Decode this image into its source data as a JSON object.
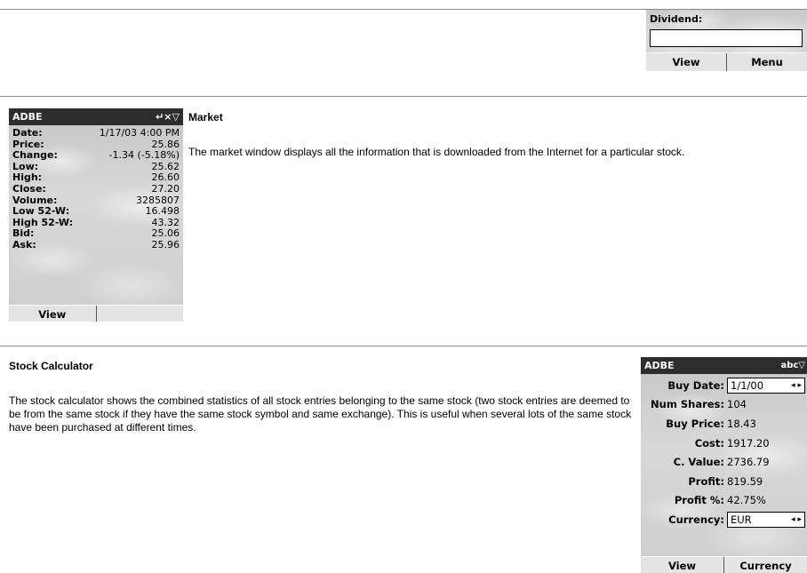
{
  "dividend_panel": {
    "label": "Dividend:",
    "value": "",
    "softkeys": [
      "View",
      "Menu"
    ]
  },
  "market_window": {
    "title": "ADBE",
    "title_icons": "↵×▽",
    "rows": [
      {
        "label": "Date:",
        "value": "1/17/03 4:00 PM"
      },
      {
        "label": "Price:",
        "value": "25.86"
      },
      {
        "label": "Change:",
        "value": "-1.34 (-5.18%)"
      },
      {
        "label": "Low:",
        "value": "25.62"
      },
      {
        "label": "High:",
        "value": "26.60"
      },
      {
        "label": "Close:",
        "value": "27.20"
      },
      {
        "label": "Volume:",
        "value": "3285807"
      },
      {
        "label": "Low 52-W:",
        "value": "16.498"
      },
      {
        "label": "High 52-W:",
        "value": "43.32"
      },
      {
        "label": "Bid:",
        "value": "25.06"
      },
      {
        "label": "Ask:",
        "value": "25.96"
      }
    ],
    "softkeys": [
      "View",
      ""
    ]
  },
  "market_section": {
    "heading": "Market",
    "text": "The market window displays all the information that is downloaded from the Internet for a particular stock."
  },
  "calculator_section": {
    "heading": "Stock Calculator",
    "text": "The stock calculator shows the combined statistics of all stock entries belonging to the same stock (two stock entries are deemed to be from the same stock if they have the same stock symbol and same exchange). This is useful when several lots of the same stock have been purchased at different times."
  },
  "calculator_window": {
    "title": "ADBE",
    "title_icons": "abc▽",
    "buy_date": {
      "label": "Buy Date:",
      "value": "1/1/00"
    },
    "rows": [
      {
        "label": "Num Shares:",
        "value": "104"
      },
      {
        "label": "Buy Price:",
        "value": "18.43"
      },
      {
        "label": "Cost:",
        "value": "1917.20"
      },
      {
        "label": "C. Value:",
        "value": "2736.79"
      },
      {
        "label": "Profit:",
        "value": "819.59"
      },
      {
        "label": "Profit %:",
        "value": "42.75%"
      }
    ],
    "currency": {
      "label": "Currency:",
      "value": "EUR"
    },
    "softkeys": [
      "View",
      "Currency"
    ],
    "arrows": "◂ ▸"
  }
}
